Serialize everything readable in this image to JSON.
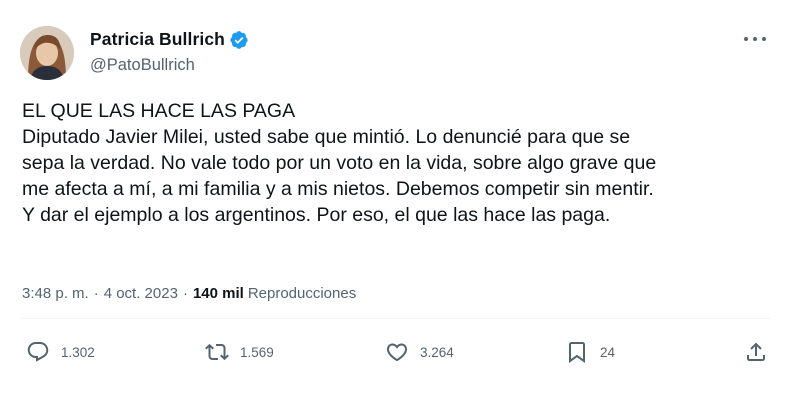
{
  "author": {
    "display_name": "Patricia Bullrich",
    "handle": "@PatoBullrich",
    "verified_color": "#1d9bf0"
  },
  "tweet": {
    "lines": [
      "EL QUE LAS HACE LAS PAGA",
      "Diputado Javier Milei, usted sabe que mintió. Lo denuncié para que se",
      "sepa la verdad. No vale todo por un voto en la vida, sobre algo grave que",
      "me afecta a mí, a mi familia y a mis nietos. Debemos competir sin mentir.",
      "Y dar el ejemplo a los argentinos. Por eso, el que las hace las paga."
    ],
    "time": "3:48 p. m.",
    "separator": "·",
    "date": "4 oct. 2023",
    "views_count": "140 mil",
    "views_label": "Reproducciones"
  },
  "actions": {
    "replies": "1.302",
    "retweets": "1.569",
    "likes": "3.264",
    "bookmarks": "24"
  },
  "icons": {
    "reply": "reply-icon",
    "retweet": "retweet-icon",
    "like": "heart-icon",
    "bookmark": "bookmark-icon",
    "share": "share-icon",
    "more": "more-icon",
    "verified": "verified-badge-icon"
  },
  "colors": {
    "text": "#0f1419",
    "secondary": "#536471",
    "accent": "#1d9bf0"
  }
}
